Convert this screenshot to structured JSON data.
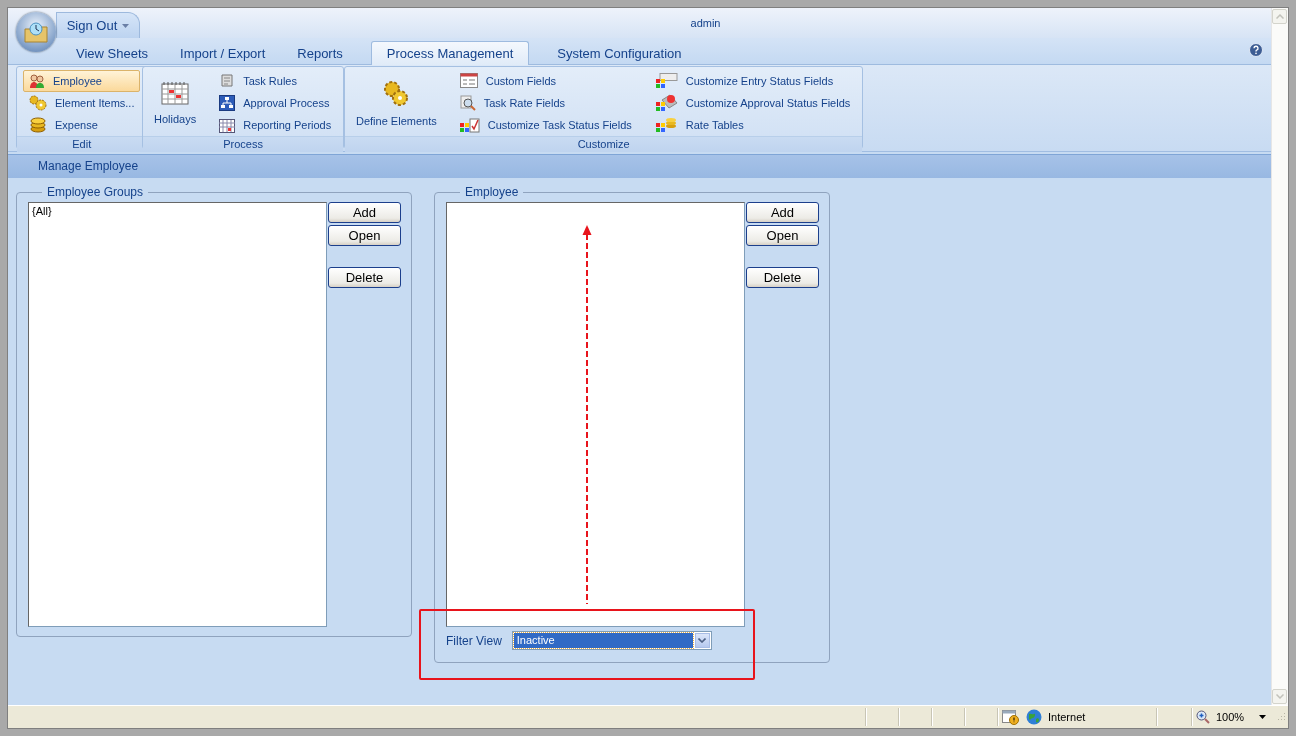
{
  "header": {
    "menu_label": "Sign Out",
    "user": "admin"
  },
  "tabs": [
    {
      "label": "View Sheets",
      "selected": false
    },
    {
      "label": "Import / Export",
      "selected": false
    },
    {
      "label": "Reports",
      "selected": false
    },
    {
      "label": "Process Management",
      "selected": true
    },
    {
      "label": "System Configuration",
      "selected": false
    }
  ],
  "ribbon_groups": [
    {
      "title": "Edit",
      "columns": [
        [
          {
            "label": "Employee",
            "selected": true
          },
          {
            "label": "Element Items...",
            "selected": false
          },
          {
            "label": "Expense",
            "selected": false
          }
        ]
      ]
    },
    {
      "title": "Process",
      "large_button": {
        "label": "Holidays",
        "selected": false
      },
      "columns": [
        [
          {
            "label": "Task Rules",
            "selected": false
          },
          {
            "label": "Approval Process",
            "selected": false
          },
          {
            "label": "Reporting Periods",
            "selected": false
          }
        ]
      ]
    },
    {
      "title": "Customize",
      "large_button": {
        "label": "Define Elements",
        "selected": false
      },
      "columns": [
        [
          {
            "label": "Custom Fields",
            "selected": false
          },
          {
            "label": "Task Rate Fields",
            "selected": false
          },
          {
            "label": "Customize Task Status Fields",
            "selected": false
          }
        ],
        [
          {
            "label": "Customize Entry Status Fields",
            "selected": false
          },
          {
            "label": "Customize Approval Status Fields",
            "selected": false
          },
          {
            "label": "Rate Tables",
            "selected": false
          }
        ]
      ]
    }
  ],
  "section_title": "Manage Employee",
  "panels": [
    {
      "title": "Employee Groups",
      "items": [
        "{All}"
      ],
      "buttons": [
        "Add",
        "Open",
        "Delete"
      ]
    },
    {
      "title": "Employee",
      "buttons": [
        "Add",
        "Open",
        "Delete"
      ],
      "filter": {
        "label": "Filter View",
        "value": "Inactive"
      }
    }
  ],
  "status_bar": {
    "zone": "Internet",
    "zoom": "100%"
  }
}
